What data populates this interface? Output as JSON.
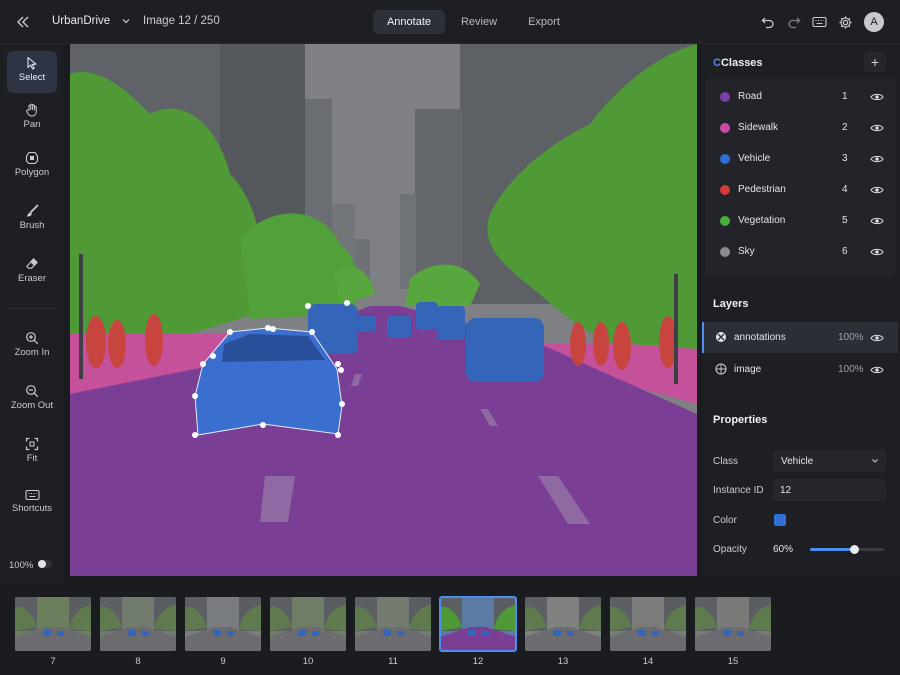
{
  "app": {
    "project": "UrbanDrive",
    "image_counter": "Image 12 / 250"
  },
  "tabs": [
    {
      "label": "Annotate",
      "active": true
    },
    {
      "label": "Review",
      "active": false
    },
    {
      "label": "Export",
      "active": false
    }
  ],
  "header_icons": [
    "undo-icon",
    "redo-icon",
    "keyboard-icon",
    "gear-icon"
  ],
  "user": {
    "initial": "A"
  },
  "tools": [
    {
      "label": "Select",
      "icon": "cursor-icon",
      "active": true
    },
    {
      "label": "Pan",
      "icon": "hand-icon",
      "active": false
    },
    {
      "label": "Polygon",
      "icon": "polygon-icon",
      "active": false
    },
    {
      "label": "Brush",
      "icon": "brush-icon",
      "active": false
    },
    {
      "label": "Eraser",
      "icon": "eraser-icon",
      "active": false
    },
    {
      "label": "Zoom In",
      "icon": "zoom-in-icon",
      "active": false
    },
    {
      "label": "Zoom Out",
      "icon": "zoom-out-icon",
      "active": false
    },
    {
      "label": "Fit",
      "icon": "fit-icon",
      "active": false
    },
    {
      "label": "Shortcuts",
      "icon": "keyboard-icon",
      "active": false
    }
  ],
  "zoom": {
    "percent": "100%"
  },
  "classes": {
    "title_prefix": "C",
    "title": "Classes",
    "items": [
      {
        "name": "Road",
        "key": "1",
        "color": "#7b3fa6"
      },
      {
        "name": "Sidewalk",
        "key": "2",
        "color": "#c94aa3"
      },
      {
        "name": "Vehicle",
        "key": "3",
        "color": "#2f6fd6"
      },
      {
        "name": "Pedestrian",
        "key": "4",
        "color": "#d63a3a"
      },
      {
        "name": "Vegetation",
        "key": "5",
        "color": "#46b03a"
      },
      {
        "name": "Sky",
        "key": "6",
        "color": "#8a8c92"
      }
    ]
  },
  "layers": {
    "title": "Layers",
    "items": [
      {
        "name": "annotations",
        "opacity": "100%",
        "active": true
      },
      {
        "name": "image",
        "opacity": "100%",
        "active": false
      }
    ]
  },
  "properties": {
    "title": "Properties",
    "class_label": "Class",
    "class_value": "Vehicle",
    "id_label": "Instance ID",
    "id_value": "12",
    "color_label": "Color",
    "color": "#2f6fd6",
    "opacity_label": "Opacity",
    "opacity_value": "60%",
    "opacity_fraction": 0.6
  },
  "filmstrip": [
    {
      "number": "7"
    },
    {
      "number": "8"
    },
    {
      "number": "9"
    },
    {
      "number": "10"
    },
    {
      "number": "11"
    },
    {
      "number": "12",
      "active": true
    },
    {
      "number": "13"
    },
    {
      "number": "14"
    },
    {
      "number": "15"
    }
  ]
}
